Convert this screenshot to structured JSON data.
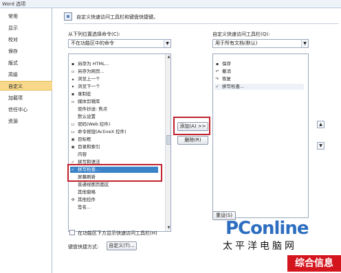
{
  "window": {
    "title": "Word 选项"
  },
  "sidebar": {
    "items": [
      {
        "label": "常用"
      },
      {
        "label": "显示"
      },
      {
        "label": "校对"
      },
      {
        "label": "保存"
      },
      {
        "label": "版式"
      },
      {
        "label": "高级"
      },
      {
        "label": "自定义",
        "selected": true
      },
      {
        "label": "加载项"
      },
      {
        "label": "信任中心"
      },
      {
        "label": "资源"
      }
    ]
  },
  "header": {
    "text": "自定义快速访问工具栏和键盘快捷键。"
  },
  "left": {
    "choose_label": "从下列位置选择命令(C):",
    "choose_value": "不在功能区中的命令",
    "commands": [
      {
        "label": "另存为 HTML...",
        "icon": "save-icon"
      },
      {
        "label": "另存为网页...",
        "icon": "web-icon"
      },
      {
        "label": "浏览上一个",
        "icon": "up-icon"
      },
      {
        "label": "浏览下一个",
        "icon": "down-icon"
      },
      {
        "label": "录制宏",
        "icon": "macro-icon"
      },
      {
        "label": "媒体剪辑库",
        "icon": "clip-icon"
      },
      {
        "label": "密件抄送: 焦点",
        "icon": ""
      },
      {
        "label": "默认设置",
        "icon": ""
      },
      {
        "label": "密码(Web 控件)",
        "icon": "password-icon"
      },
      {
        "label": "命令按钮(ActiveX 控件)",
        "icon": "button-icon"
      },
      {
        "label": "目标框",
        "icon": "target-icon"
      },
      {
        "label": "目录和索引",
        "icon": "index-icon"
      },
      {
        "label": "内容",
        "icon": ""
      },
      {
        "label": "拼写和语法",
        "icon": "spell-icon"
      },
      {
        "label": "拼写检查...",
        "icon": "spellcheck-icon",
        "highlighted": true
      },
      {
        "label": "屏幕刷新",
        "icon": ""
      },
      {
        "label": "普通视图页面区",
        "icon": ""
      },
      {
        "label": "其他窗格",
        "icon": ""
      },
      {
        "label": "其他控件",
        "icon": "controls-icon"
      },
      {
        "label": "签名...",
        "icon": ""
      }
    ]
  },
  "middle": {
    "add_label": "添加(A) >>",
    "remove_label": "删除(R)"
  },
  "right": {
    "customize_label": "自定义快速访问工具栏(Q):",
    "customize_value": "用于所有文档(默认)",
    "items": [
      {
        "label": "保存",
        "icon": "save-icon"
      },
      {
        "label": "撤消",
        "icon": "undo-icon"
      },
      {
        "label": "恢复",
        "icon": "redo-icon"
      },
      {
        "label": "拼写检查...",
        "icon": "spellcheck-icon"
      }
    ],
    "reset_label": "重设(S)"
  },
  "footer": {
    "show_below_label": "在功能区下方显示快速访问工具栏(H)",
    "keyboard_label": "键盘快捷方式:",
    "customize_button": "自定义(T)..."
  },
  "watermark": {
    "brand": "PConline",
    "sub": "太平洋电脑网",
    "site": "综合信息"
  }
}
